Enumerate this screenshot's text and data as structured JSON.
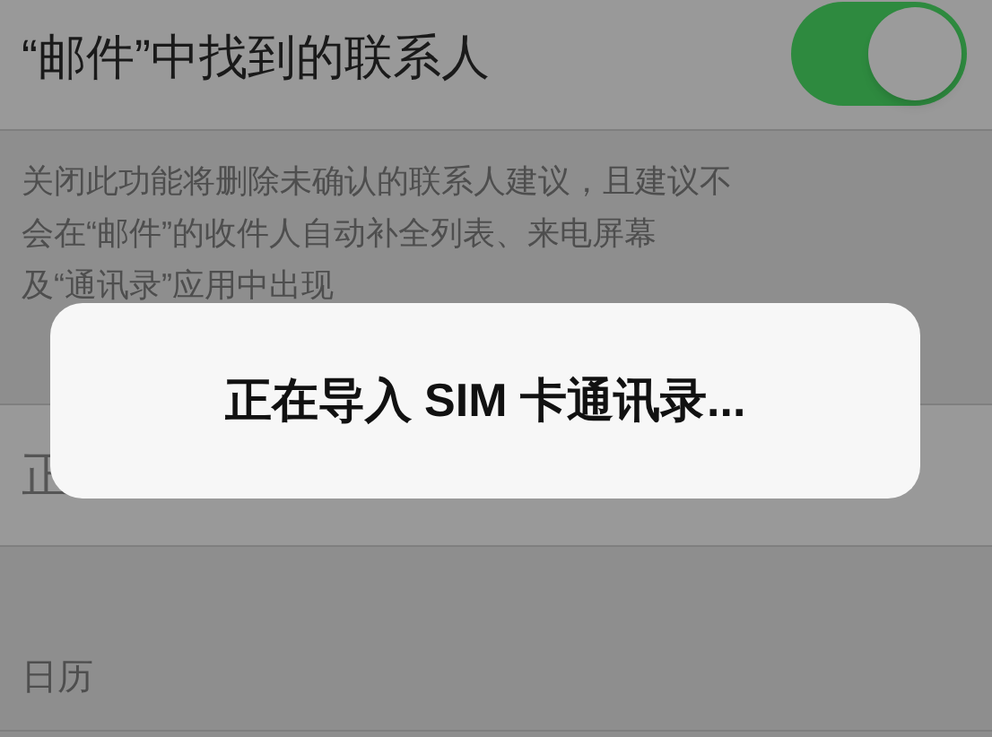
{
  "contacts_found_in_mail": {
    "label": "“邮件”中找到的联系人",
    "on": true
  },
  "footer_note": [
    "关闭此功能将删除未确认的联系人建议，且建议不",
    "会在“邮件”的收件人自动补全列表、来电屏幕",
    "及“通讯录”应用中出现"
  ],
  "import_row": {
    "label": "正"
  },
  "section_header": "日历",
  "alert": {
    "message": "正在导入 SIM 卡通讯录..."
  }
}
